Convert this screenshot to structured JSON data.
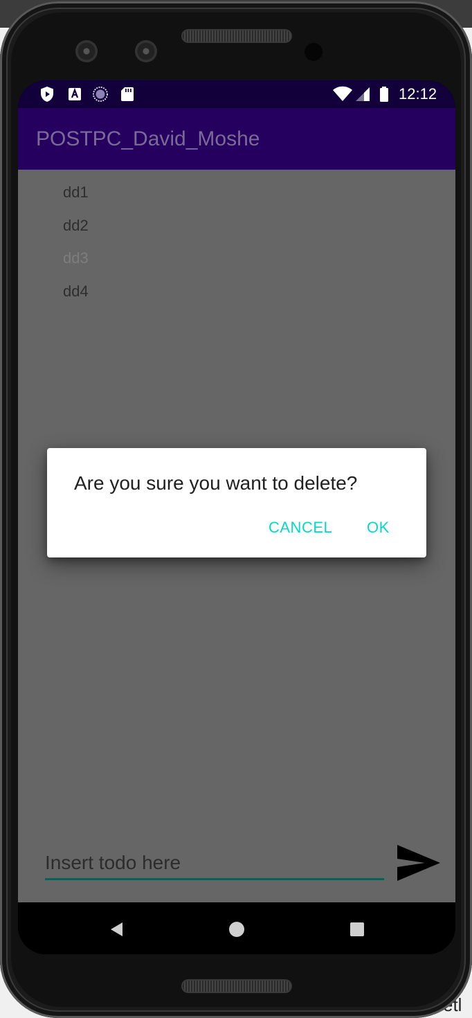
{
  "status_bar": {
    "time": "12:12",
    "left_icons": [
      "play-protect-icon",
      "a-badge-icon",
      "sync-circle-icon",
      "sd-card-icon"
    ],
    "right_icons": [
      "wifi-icon",
      "cellular-signal-icon",
      "battery-icon"
    ]
  },
  "app_bar": {
    "title": "POSTPC_David_Moshe",
    "background": "#26005e"
  },
  "todo_list": {
    "items": [
      {
        "label": "dd1"
      },
      {
        "label": "dd2"
      },
      {
        "label": "dd3"
      },
      {
        "label": "dd4"
      }
    ]
  },
  "input": {
    "placeholder": "Insert todo here",
    "send_icon": "send-icon"
  },
  "dialog": {
    "message": "Are you sure you want to delete?",
    "cancel_label": "CANCEL",
    "ok_label": "OK",
    "accent": "#03dac5"
  },
  "navigation": {
    "buttons": [
      "back-icon",
      "home-icon",
      "recents-icon"
    ]
  },
  "background_text": "etl"
}
